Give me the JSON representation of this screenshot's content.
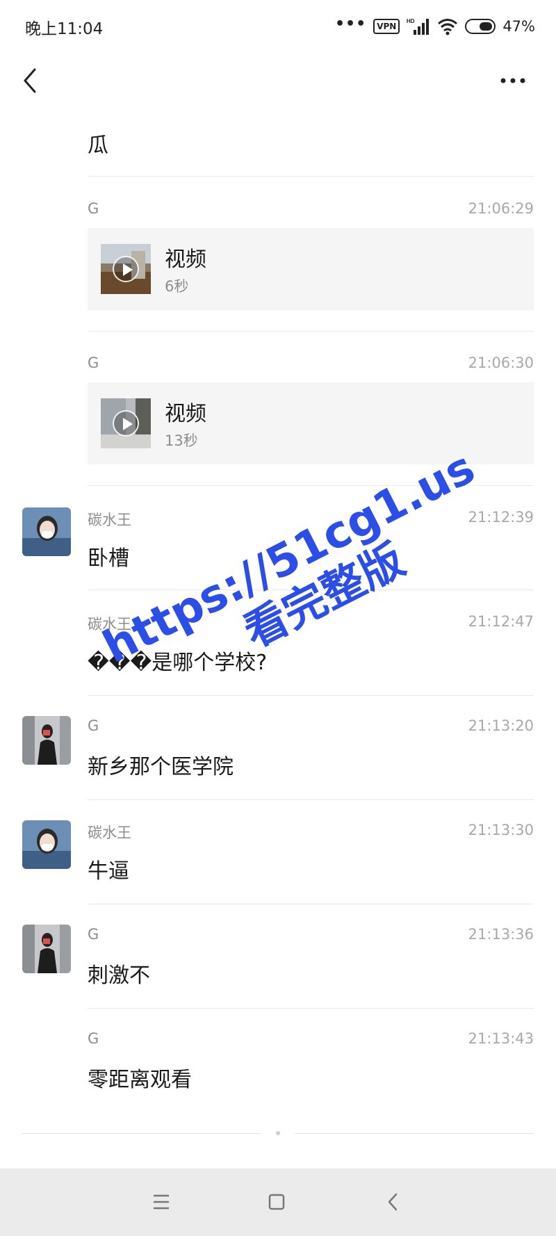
{
  "status_bar": {
    "time": "晚上11:04",
    "vpn": "VPN",
    "battery": "47%",
    "icons": [
      "more-dots-icon",
      "vpn-icon",
      "hd-signal-icon",
      "wifi-icon",
      "battery-icon"
    ]
  },
  "header": {
    "back_icon": "chevron-left-icon",
    "more_icon": "more-horizontal-icon"
  },
  "messages": [
    {
      "type": "text",
      "text": "瓜"
    },
    {
      "type": "video",
      "sender": "G",
      "time": "21:06:29",
      "title": "视频",
      "duration": "6秒"
    },
    {
      "type": "video",
      "sender": "G",
      "time": "21:06:30",
      "title": "视频",
      "duration": "13秒"
    },
    {
      "type": "text",
      "sender": "碳水王",
      "time": "21:12:39",
      "text": "卧槽",
      "avatar": "avatar-tanshuiwang"
    },
    {
      "type": "text",
      "sender": "碳水王",
      "time": "21:12:47",
      "text": "���是哪个学校?"
    },
    {
      "type": "text",
      "sender": "G",
      "time": "21:13:20",
      "text": "新乡那个医学院",
      "avatar": "avatar-g"
    },
    {
      "type": "text",
      "sender": "碳水王",
      "time": "21:13:30",
      "text": "牛逼",
      "avatar": "avatar-tanshuiwang"
    },
    {
      "type": "text",
      "sender": "G",
      "time": "21:13:36",
      "text": "刺激不",
      "avatar": "avatar-g"
    },
    {
      "type": "text",
      "sender": "G",
      "time": "21:13:43",
      "text": "零距离观看"
    }
  ],
  "watermark": {
    "line1": "https://51cg1.us",
    "line2": "看完整版",
    "color": "#2b4ee8"
  },
  "nav_bar": {
    "icons": [
      "menu-icon",
      "home-square-icon",
      "back-triangle-icon"
    ]
  },
  "colors": {
    "background": "#ffffff",
    "card_bg": "#f5f5f5",
    "secondary_text": "#8c8c8c",
    "nav_bg": "#ebebeb"
  }
}
